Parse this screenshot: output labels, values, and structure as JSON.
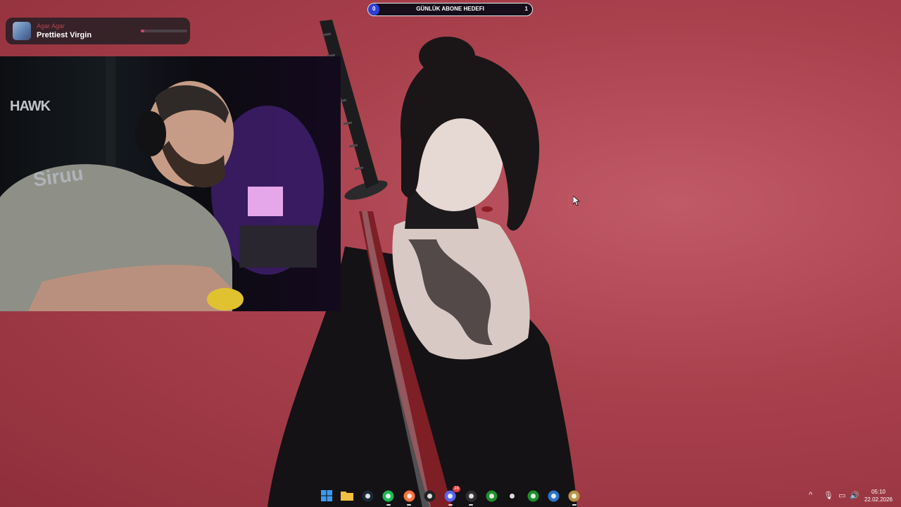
{
  "now_playing": {
    "artist": "Agar Agar",
    "title": "Prettiest Virgin",
    "progress_fraction": 0.08
  },
  "subscriber_goal": {
    "title": "GÜNLÜK ABONE HEDEFI",
    "current": "0",
    "target": "1",
    "progress_fraction": 0.06
  },
  "webcam": {
    "sign_1": "HAWK",
    "sign_2": "Siruu"
  },
  "taskbar": {
    "icons": [
      {
        "name": "start-icon",
        "color": "#3a9bf0",
        "running": false
      },
      {
        "name": "file-explorer-icon",
        "color": "#f0c040",
        "running": false
      },
      {
        "name": "steam-icon",
        "color": "#1b2838",
        "running": false
      },
      {
        "name": "spotify-icon",
        "color": "#1db954",
        "running": true
      },
      {
        "name": "firefox-icon",
        "color": "#ff7139",
        "running": true
      },
      {
        "name": "steelseries-icon",
        "color": "#222222",
        "running": false
      },
      {
        "name": "discord-icon",
        "color": "#5865f2",
        "badge": "28",
        "running": true
      },
      {
        "name": "obs-icon",
        "color": "#302e31",
        "running": true
      },
      {
        "name": "razer-icon",
        "color": "#1f8f2f",
        "running": false
      },
      {
        "name": "capcut-icon",
        "color": "#111111",
        "running": false
      },
      {
        "name": "nvidia-icon",
        "color": "#1f8f2f",
        "running": false
      },
      {
        "name": "battlenet-icon",
        "color": "#2a74c6",
        "running": false
      },
      {
        "name": "league-icon",
        "color": "#b89443",
        "running": true
      }
    ]
  },
  "system_tray": {
    "chevron_icon": "^",
    "mic_icon": "🎙",
    "display_icon": "▭",
    "volume_icon": "🔊",
    "time": "05:10",
    "date": "22.02.2026"
  }
}
